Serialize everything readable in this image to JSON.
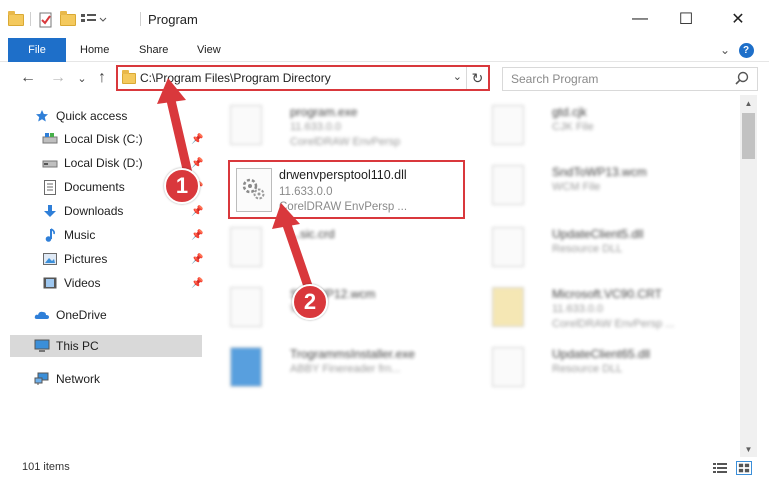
{
  "window": {
    "title": "Program",
    "minimize_glyph": "—",
    "maximize_glyph": "☐",
    "close_glyph": "✕"
  },
  "ribbon": {
    "tabs": [
      "File",
      "Home",
      "Share",
      "View"
    ],
    "help_glyph": "?",
    "collapse_glyph": "⌄"
  },
  "navigation": {
    "back_glyph": "←",
    "forward_glyph": "→",
    "recent_glyph": "⌄",
    "up_glyph": "↑"
  },
  "address_bar": {
    "path": "C:\\Program Files\\Program Directory",
    "dropdown_glyph": "⌄",
    "refresh_glyph": "↻"
  },
  "search": {
    "placeholder": "Search Program"
  },
  "sidebar": {
    "quick_access": "Quick access",
    "items": [
      {
        "label": "Local Disk (C:)",
        "icon": "drive-icon"
      },
      {
        "label": "Local Disk (D:)",
        "icon": "drive-icon"
      },
      {
        "label": "Documents",
        "icon": "documents-icon"
      },
      {
        "label": "Downloads",
        "icon": "downloads-icon"
      },
      {
        "label": "Music",
        "icon": "music-icon"
      },
      {
        "label": "Pictures",
        "icon": "pictures-icon"
      },
      {
        "label": "Videos",
        "icon": "videos-icon"
      }
    ],
    "onedrive": "OneDrive",
    "this_pc": "This PC",
    "network": "Network"
  },
  "files": {
    "left_column": [
      {
        "name": "program.exe",
        "line2": "11.633.0.0",
        "line3": "CorelDRAW EnvPersp"
      },
      {
        "name": "drwenvpersptool110.dll",
        "line2": "11.633.0.0",
        "line3": "CorelDRAW EnvPersp ..."
      },
      {
        "name": "...sic.crd",
        "line2": "",
        "line3": ""
      },
      {
        "name": "Sn...WP12.wcm",
        "line2": "W...",
        "line3": ""
      },
      {
        "name": "TrogrammsInstaller.exe",
        "line2": "ABBY Finereader frn...",
        "line3": ""
      }
    ],
    "right_column": [
      {
        "name": "gtd.cjk",
        "line2": "CJK File",
        "line3": ""
      },
      {
        "name": "SndToWP13.wcm",
        "line2": "WCM File",
        "line3": ""
      },
      {
        "name": "UpdateClient5.dll",
        "line2": "Resource DLL",
        "line3": ""
      },
      {
        "name": "Microsoft.VC90.CRT",
        "line2": "11.633.0.0",
        "line3": "CorelDRAW EnvPersp ..."
      },
      {
        "name": "UpdateClient65.dll",
        "line2": "Resource DLL",
        "line3": ""
      }
    ]
  },
  "status": {
    "item_count": "101 items"
  },
  "annotations": {
    "step1": "1",
    "step2": "2",
    "accent_color": "#d9383c"
  }
}
